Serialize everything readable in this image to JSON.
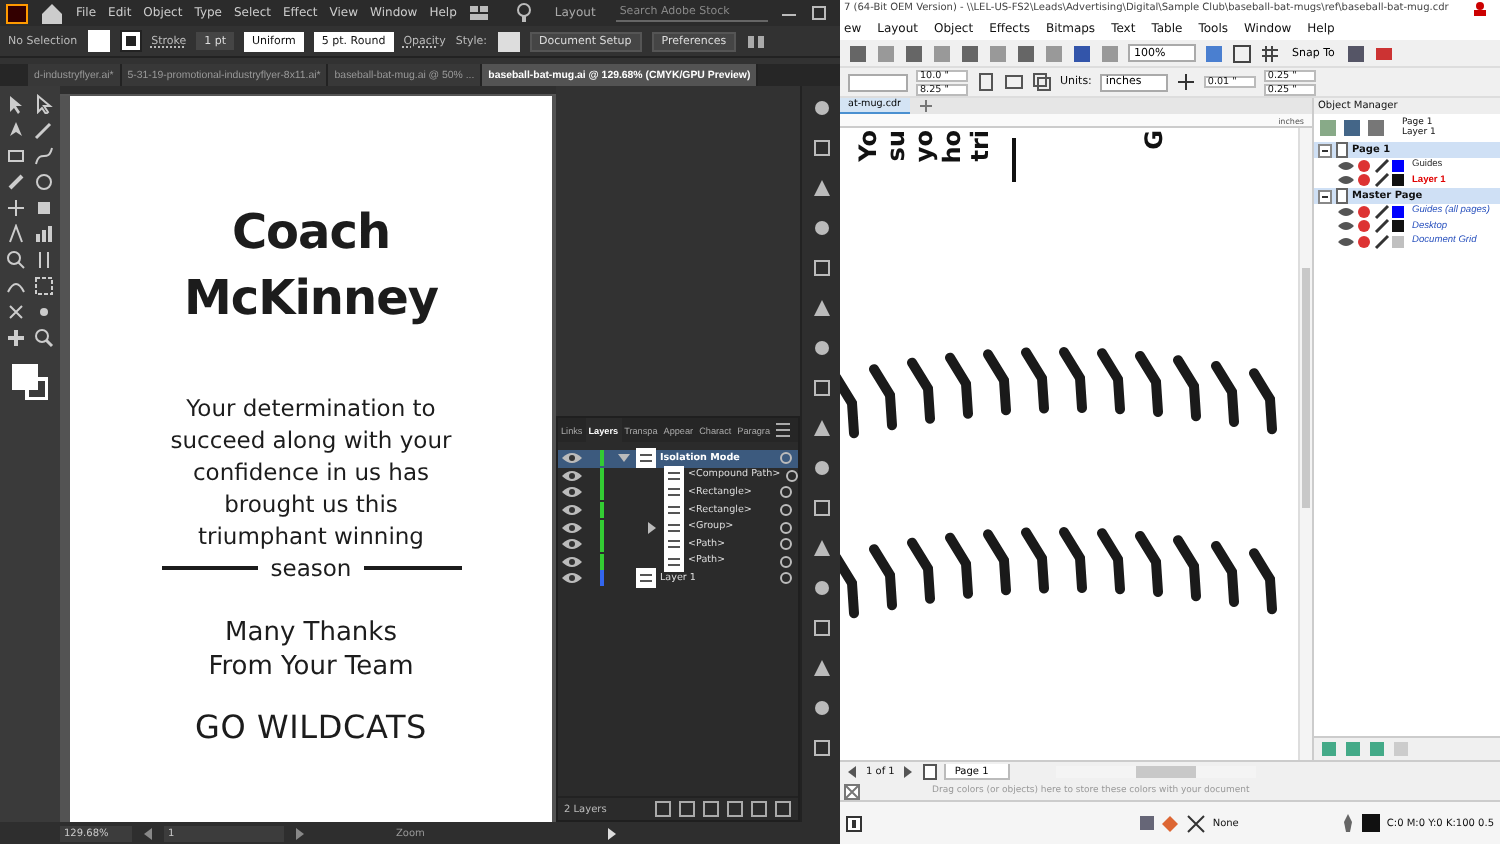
{
  "illustrator": {
    "menu": [
      "File",
      "Edit",
      "Object",
      "Type",
      "Select",
      "Effect",
      "View",
      "Window",
      "Help"
    ],
    "workspace": "Layout",
    "search": {
      "placeholder": "Search Adobe Stock"
    },
    "control_bar": {
      "selection": "No Selection",
      "stroke_label": "Stroke",
      "stroke_weight": "1 pt",
      "profile": "Uniform",
      "brush": "5 pt. Round",
      "opacity_label": "Opacity",
      "style_label": "Style:",
      "document_setup": "Document Setup",
      "preferences": "Preferences"
    },
    "tabs": [
      {
        "label": "d-industryflyer.ai*",
        "selected": false
      },
      {
        "label": "5-31-19-promotional-industryflyer-8x11.ai*",
        "selected": false
      },
      {
        "label": "baseball-bat-mug.ai @ 50% ...",
        "selected": false
      },
      {
        "label": "baseball-bat-mug.ai @ 129.68% (CMYK/GPU Preview)",
        "selected": true
      }
    ],
    "artboard": {
      "title": [
        "Coach",
        "McKinney"
      ],
      "message": "Your determination to succeed along with your confidence in us has brought us this triumphant winning",
      "last_word": "season",
      "thanks": [
        "Many Thanks",
        "From Your Team"
      ],
      "signoff": "GO WILDCATS"
    },
    "layers_panel": {
      "tabs": [
        {
          "label": "Links",
          "selected": false
        },
        {
          "label": "Layers",
          "selected": true
        },
        {
          "label": "Transpa",
          "selected": false
        },
        {
          "label": "Appear",
          "selected": false
        },
        {
          "label": "Charact",
          "selected": false
        },
        {
          "label": "Paragra",
          "selected": false
        }
      ],
      "rows": [
        {
          "label": "Isolation Mode",
          "color": "#33cc33",
          "expanded": true,
          "selected": true,
          "children": [
            {
              "label": "<Compound Path>",
              "selected": false
            },
            {
              "label": "<Rectangle>",
              "selected": false
            },
            {
              "label": "<Rectangle>",
              "selected": false
            },
            {
              "label": "<Group>",
              "expanded": false,
              "selected": false
            },
            {
              "label": "<Path>",
              "selected": false
            },
            {
              "label": "<Path>",
              "selected": false
            }
          ]
        },
        {
          "label": "Layer 1",
          "color": "#3366ee",
          "selected": false
        }
      ],
      "count": "2 Layers"
    },
    "status_bar": {
      "zoom": "129.68%",
      "artboard": "1",
      "tool": "Zoom"
    }
  },
  "coreldraw": {
    "title": "7 (64-Bit OEM Version) - \\\\LEL-US-FS2\\Leads\\Advertising\\Digital\\Sample Club\\baseball-bat-mugs\\ref\\baseball-bat-mug.cdr",
    "menu": [
      "ew",
      "Layout",
      "Object",
      "Effects",
      "Bitmaps",
      "Text",
      "Table",
      "Tools",
      "Window",
      "Help"
    ],
    "zoom": "100%",
    "snap": "Snap To",
    "property_bar": {
      "width": "10.0 \"",
      "height": "8.25 \"",
      "units_label": "Units:",
      "units": "inches",
      "nudge": "0.01 \"",
      "duplicate_x": "0.25 \"",
      "duplicate_y": "0.25 \""
    },
    "document_tab": "at-mug.cdr",
    "ruler_unit": "inches",
    "rotated_text": [
      "Yo",
      "su",
      "yo",
      "ho",
      "tri"
    ],
    "rotated_letter": "G",
    "object_manager": {
      "title": "Object Manager",
      "page": "Page 1",
      "layer": "Layer 1",
      "tree": [
        {
          "label": "Page 1",
          "kind": "page",
          "expanded": true,
          "children": [
            {
              "label": "Guides",
              "color": "#0000ff",
              "active": false
            },
            {
              "label": "Layer 1",
              "color": "#111111",
              "active": true
            }
          ]
        },
        {
          "label": "Master Page",
          "kind": "master",
          "expanded": true,
          "children": [
            {
              "label": "Guides (all pages)",
              "color": "#0000ff",
              "active": false
            },
            {
              "label": "Desktop",
              "color": "#111111",
              "active": false
            },
            {
              "label": "Document Grid",
              "color": "#c0c0c0",
              "active": false
            }
          ]
        }
      ]
    },
    "page_nav": {
      "counter": "1 of 1",
      "page_tab": "Page 1"
    },
    "palette_hint": "Drag colors (or objects) here to store these colors with your document",
    "status_bar": {
      "fill": "None",
      "outline": "C:0 M:0 Y:0 K:100 0.5"
    }
  }
}
